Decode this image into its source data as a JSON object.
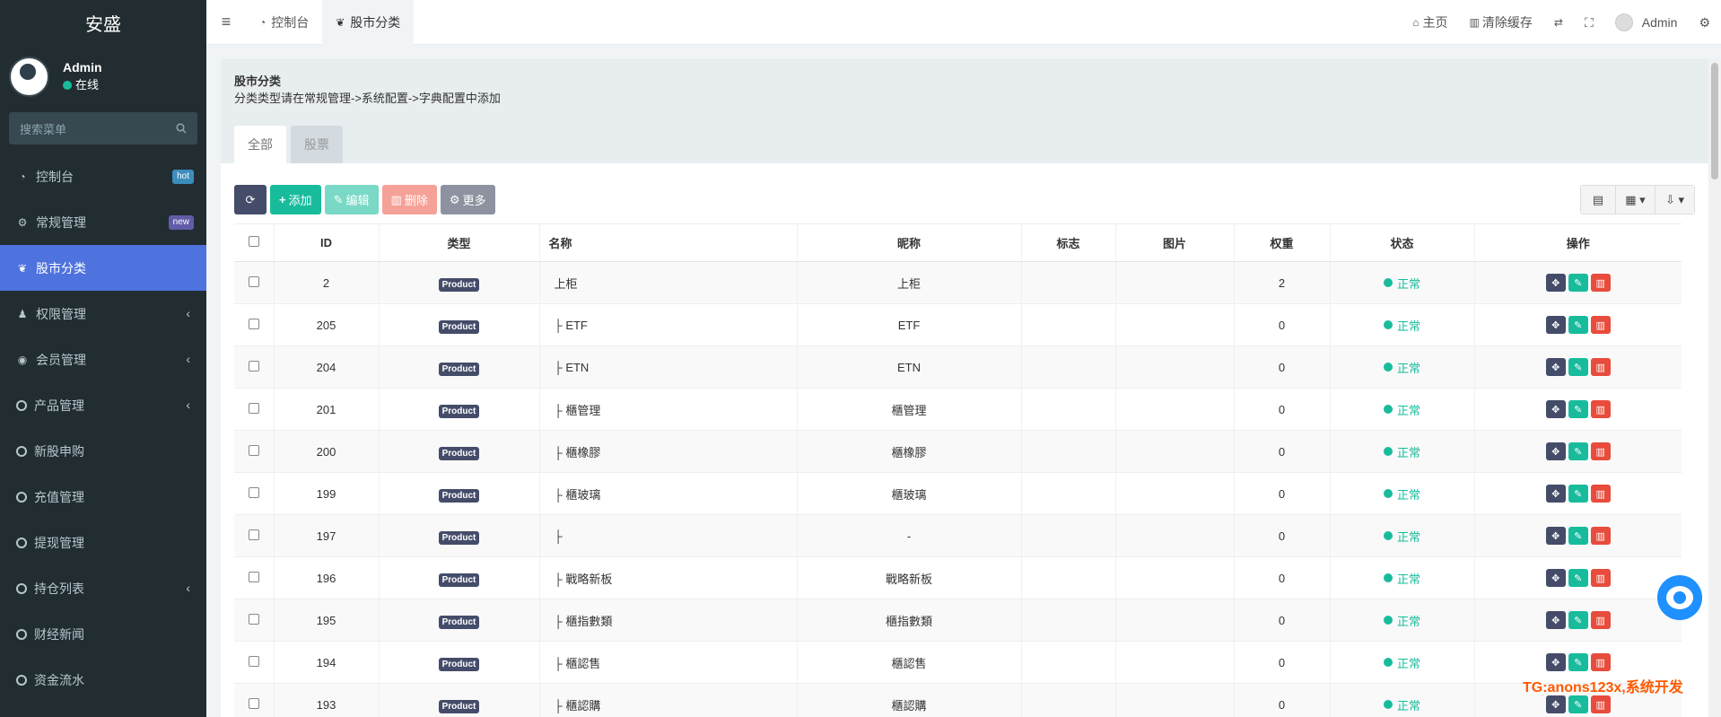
{
  "sidebar": {
    "brand": "安盛",
    "user": {
      "name": "Admin",
      "status": "在线"
    },
    "search_placeholder": "搜索菜单",
    "items": [
      {
        "label": "控制台",
        "icon": "dashboard-icon",
        "badge": "hot"
      },
      {
        "label": "常规管理",
        "icon": "cogs-icon",
        "badge": "new"
      },
      {
        "label": "股市分类",
        "icon": "leaf-icon",
        "active": true
      },
      {
        "label": "权限管理",
        "icon": "group-icon",
        "chevron": true
      },
      {
        "label": "会员管理",
        "icon": "user-circle-icon",
        "chevron": true
      },
      {
        "label": "产品管理",
        "icon": "circle-icon",
        "chevron": true
      },
      {
        "label": "新股申购",
        "icon": "circle-icon"
      },
      {
        "label": "充值管理",
        "icon": "circle-icon"
      },
      {
        "label": "提现管理",
        "icon": "circle-icon"
      },
      {
        "label": "持仓列表",
        "icon": "circle-icon",
        "chevron": true
      },
      {
        "label": "财经新闻",
        "icon": "circle-icon"
      },
      {
        "label": "资金流水",
        "icon": "circle-icon"
      }
    ]
  },
  "topbar": {
    "tabs": [
      {
        "label": "控制台",
        "icon": "dashboard-icon"
      },
      {
        "label": "股市分类",
        "icon": "leaf-icon",
        "active": true
      }
    ],
    "right": {
      "home": "主页",
      "clear_cache": "清除缓存",
      "user": "Admin"
    }
  },
  "panel": {
    "title": "股市分类",
    "desc": "分类类型请在常规管理->系统配置->字典配置中添加",
    "tabs": [
      "全部",
      "股票"
    ]
  },
  "toolbar": {
    "add": "添加",
    "edit": "编辑",
    "delete": "删除",
    "more": "更多"
  },
  "table": {
    "headers": [
      "ID",
      "类型",
      "名称",
      "昵称",
      "标志",
      "图片",
      "权重",
      "状态",
      "操作"
    ],
    "rows": [
      {
        "id": "2",
        "type": "Product",
        "name": "上柜",
        "nickname": "上柜",
        "weight": "2",
        "status": "正常"
      },
      {
        "id": "205",
        "type": "Product",
        "name": "├ ETF",
        "nickname": "ETF",
        "weight": "0",
        "status": "正常"
      },
      {
        "id": "204",
        "type": "Product",
        "name": "├ ETN",
        "nickname": "ETN",
        "weight": "0",
        "status": "正常"
      },
      {
        "id": "201",
        "type": "Product",
        "name": "├ 櫃管理",
        "nickname": "櫃管理",
        "weight": "0",
        "status": "正常"
      },
      {
        "id": "200",
        "type": "Product",
        "name": "├ 櫃橡膠",
        "nickname": "櫃橡膠",
        "weight": "0",
        "status": "正常"
      },
      {
        "id": "199",
        "type": "Product",
        "name": "├ 櫃玻璃",
        "nickname": "櫃玻璃",
        "weight": "0",
        "status": "正常"
      },
      {
        "id": "197",
        "type": "Product",
        "name": "├",
        "nickname": "-",
        "weight": "0",
        "status": "正常"
      },
      {
        "id": "196",
        "type": "Product",
        "name": "├ 戰略新板",
        "nickname": "戰略新板",
        "weight": "0",
        "status": "正常"
      },
      {
        "id": "195",
        "type": "Product",
        "name": "├ 櫃指數類",
        "nickname": "櫃指數類",
        "weight": "0",
        "status": "正常"
      },
      {
        "id": "194",
        "type": "Product",
        "name": "├ 櫃認售",
        "nickname": "櫃認售",
        "weight": "0",
        "status": "正常"
      },
      {
        "id": "193",
        "type": "Product",
        "name": "├ 櫃認購",
        "nickname": "櫃認購",
        "weight": "0",
        "status": "正常"
      }
    ]
  },
  "watermark": "TG:anons123x,系统开发",
  "colors": {
    "accent": "#4e73df",
    "success": "#18bc9c",
    "danger": "#e74c3c",
    "sidebar": "#222d32"
  }
}
